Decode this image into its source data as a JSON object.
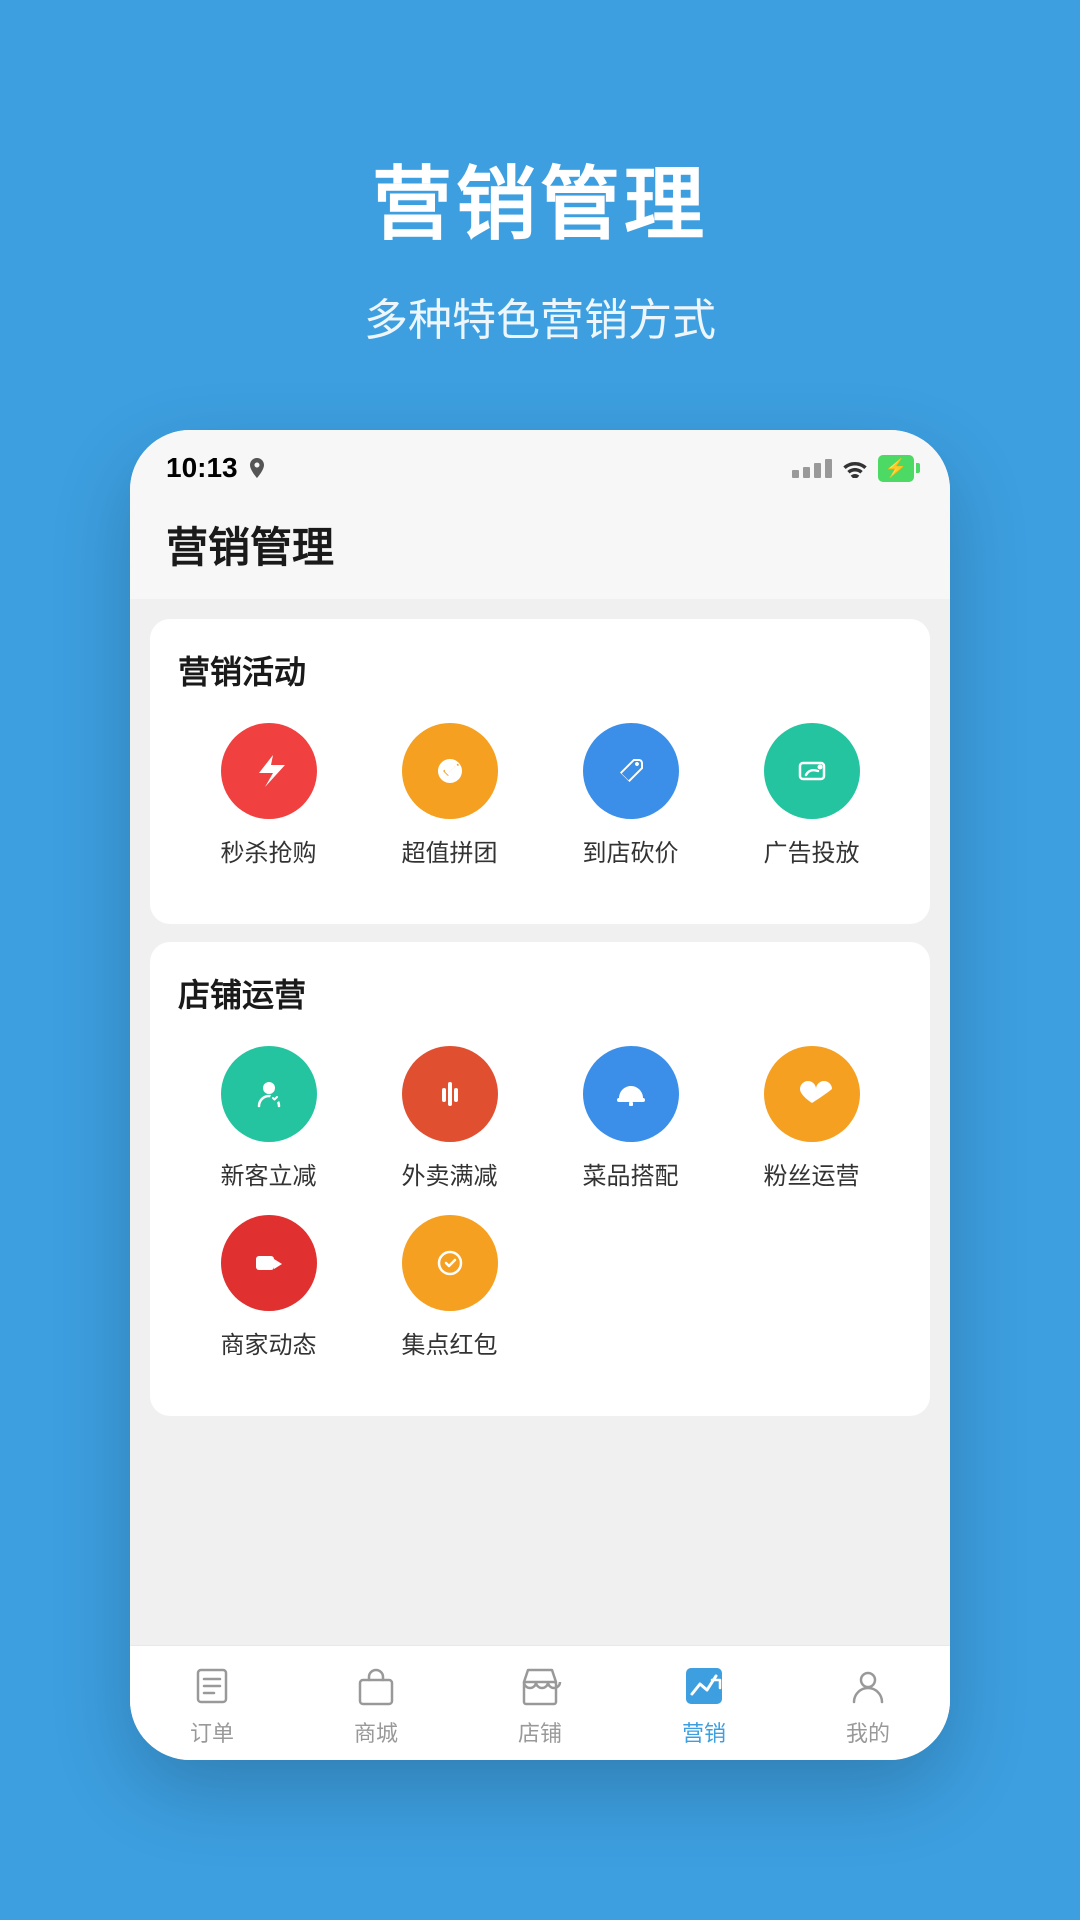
{
  "background_color": "#3d9fe0",
  "header": {
    "title": "营销管理",
    "subtitle": "多种特色营销方式"
  },
  "status_bar": {
    "time": "10:13",
    "has_location": true
  },
  "page": {
    "title": "营销管理"
  },
  "sections": [
    {
      "id": "marketing-activities",
      "title": "营销活动",
      "items": [
        {
          "id": "flash-sale",
          "label": "秒杀抢购",
          "color": "#f04040",
          "icon": "flash"
        },
        {
          "id": "group-buy",
          "label": "超值拼团",
          "color": "#f5a020",
          "icon": "puzzle"
        },
        {
          "id": "in-store-discount",
          "label": "到店砍价",
          "color": "#3b8fe8",
          "icon": "tag"
        },
        {
          "id": "ad-placement",
          "label": "广告投放",
          "color": "#25c4a0",
          "icon": "ad"
        }
      ]
    },
    {
      "id": "store-operations",
      "title": "店铺运营",
      "items": [
        {
          "id": "new-customer-discount",
          "label": "新客立减",
          "color": "#25c4a0",
          "icon": "person"
        },
        {
          "id": "delivery-discount",
          "label": "外卖满减",
          "color": "#e05030",
          "icon": "fork"
        },
        {
          "id": "menu-combo",
          "label": "菜品搭配",
          "color": "#3b8fe8",
          "icon": "thumb"
        },
        {
          "id": "fan-operation",
          "label": "粉丝运营",
          "color": "#f5a020",
          "icon": "heart"
        },
        {
          "id": "merchant-news",
          "label": "商家动态",
          "color": "#e03030",
          "icon": "video"
        },
        {
          "id": "stamp-red-packet",
          "label": "集点红包",
          "color": "#f5a020",
          "icon": "stamp"
        }
      ]
    }
  ],
  "bottom_nav": [
    {
      "id": "orders",
      "label": "订单",
      "icon": "order",
      "active": false
    },
    {
      "id": "mall",
      "label": "商城",
      "icon": "bag",
      "active": false
    },
    {
      "id": "store",
      "label": "店铺",
      "icon": "store",
      "active": false
    },
    {
      "id": "marketing",
      "label": "营销",
      "icon": "chart",
      "active": true
    },
    {
      "id": "mine",
      "label": "我的",
      "icon": "person",
      "active": false
    }
  ]
}
